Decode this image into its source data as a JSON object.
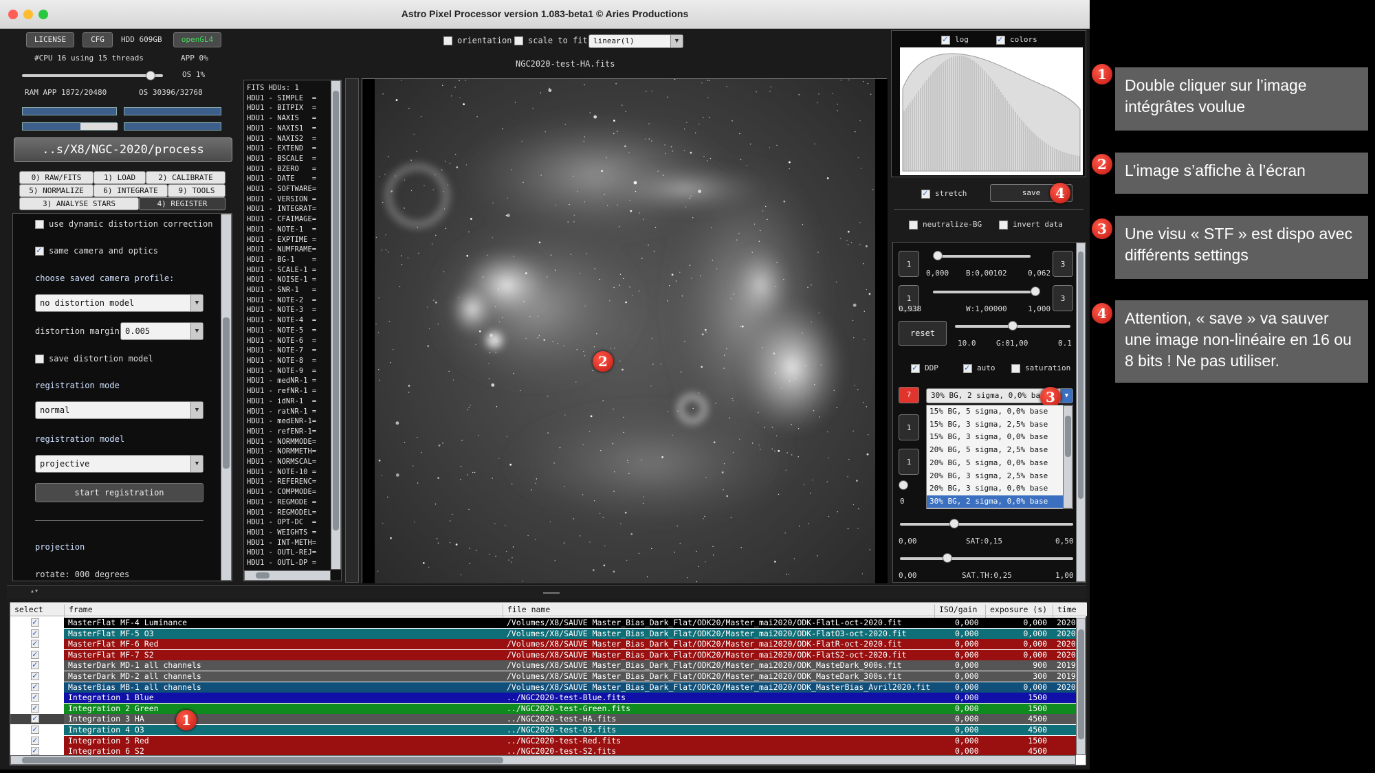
{
  "window": {
    "title": "Astro Pixel Processor version 1.083-beta1 © Aries Productions"
  },
  "status": {
    "license": "LICENSE",
    "cfg": "CFG",
    "hdd": "HDD 609GB",
    "opengl": "openGL4",
    "cpu": "#CPU 16  using 15 threads",
    "app": "APP 0%",
    "os": "OS 1%",
    "ram": "RAM  APP 1872/20480",
    "ram_os": "OS 30396/32768"
  },
  "path": "..s/X8/NGC-2020/process",
  "tabs": [
    {
      "label": "0) RAW/FITS"
    },
    {
      "label": "1) LOAD"
    },
    {
      "label": "2) CALIBRATE"
    },
    {
      "label": "5) NORMALIZE"
    },
    {
      "label": "6) INTEGRATE"
    },
    {
      "label": "9) TOOLS"
    },
    {
      "label": "3) ANALYSE STARS"
    },
    {
      "label": "4) REGISTER"
    }
  ],
  "register": {
    "dynamic_distortion": "use dynamic distortion correction",
    "same_camera": "same camera and optics",
    "choose_profile": "choose saved camera profile:",
    "profile_value": "no distortion model",
    "distortion_margin_label": "distortion margin",
    "distortion_margin_value": "0.005",
    "save_distortion": "save distortion model",
    "registration_mode_label": "registration mode",
    "registration_mode_value": "normal",
    "registration_model_label": "registration model",
    "registration_model_value": "projective",
    "start_button": "start registration",
    "projection": "projection",
    "rotate": "rotate:  000 degrees"
  },
  "fits_header": [
    "FITS HDUs: 1",
    "HDU1 - SIMPLE  =",
    "HDU1 - BITPIX  =",
    "HDU1 - NAXIS   =",
    "HDU1 - NAXIS1  =",
    "HDU1 - NAXIS2  =",
    "HDU1 - EXTEND  =",
    "HDU1 - BSCALE  =",
    "HDU1 - BZERO   =",
    "HDU1 - DATE    =",
    "HDU1 - SOFTWARE=",
    "HDU1 - VERSION =",
    "HDU1 - INTEGRAT=",
    "HDU1 - CFAIMAGE=",
    "HDU1 - NOTE-1  =",
    "HDU1 - EXPTIME =",
    "HDU1 - NUMFRAME=",
    "HDU1 - BG-1    =",
    "HDU1 - SCALE-1 =",
    "HDU1 - NOISE-1 =",
    "HDU1 - SNR-1   =",
    "HDU1 - NOTE-2  =",
    "HDU1 - NOTE-3  =",
    "HDU1 - NOTE-4  =",
    "HDU1 - NOTE-5  =",
    "HDU1 - NOTE-6  =",
    "HDU1 - NOTE-7  =",
    "HDU1 - NOTE-8  =",
    "HDU1 - NOTE-9  =",
    "HDU1 - medNR-1 =",
    "HDU1 - refNR-1 =",
    "HDU1 - idNR-1  =",
    "HDU1 - ratNR-1 =",
    "HDU1 - medENR-1=",
    "HDU1 - refENR-1=",
    "HDU1 - NORMMODE=",
    "HDU1 - NORMMETH=",
    "HDU1 - NORMSCAL=",
    "HDU1 - NOTE-10 =",
    "HDU1 - REFERENC=",
    "HDU1 - COMPMODE=",
    "HDU1 - REGMODE =",
    "HDU1 - REGMODEL=",
    "HDU1 - OPT-DC  =",
    "HDU1 - WEIGHTS =",
    "HDU1 - INT-METH=",
    "HDU1 - OUTL-REJ=",
    "HDU1 - OUTL-DP ="
  ],
  "viewer": {
    "orientation": "orientation",
    "scale_to_fit": "scale to fit",
    "stretch_mode": "linear(l)",
    "filename": "NGC2020-test-HA.fits"
  },
  "histogram": {
    "log": "log",
    "colors": "colors"
  },
  "stretch": {
    "stretch_label": "stretch",
    "save_label": "save",
    "neutralize": "neutralize-BG",
    "invert": "invert data",
    "b_min": "0,000",
    "b_val": "B:0,00102",
    "b_max": "0,062",
    "w_min": "0,938",
    "w_val": "W:1,00000",
    "w_max": "1,000",
    "reset": "reset",
    "g_min": "10.0",
    "g_val": "G:01,00",
    "g_max": "0.1",
    "ddp": "DDP",
    "auto": "auto",
    "saturation": "saturation",
    "question": "?",
    "preset_selected": "30% BG, 2 sigma, 0,0% ba",
    "presets": [
      "15% BG, 5 sigma, 0,0% base",
      "15% BG, 3 sigma, 2,5% base",
      "15% BG, 3 sigma, 0,0% base",
      "20% BG, 5 sigma, 2,5% base",
      "20% BG, 5 sigma, 0,0% base",
      "20% BG, 3 sigma, 2,5% base",
      "20% BG, 3 sigma, 0,0% base",
      "30% BG, 2 sigma, 0,0% base"
    ],
    "zero": "0",
    "sat_min": "0,00",
    "sat_val": "SAT:0,15",
    "sat_max": "0,50",
    "satth_min": "0,00",
    "satth_val": "SAT.TH:0,25",
    "satth_max": "1,00",
    "one": "1",
    "three": "3"
  },
  "filelist": {
    "headers": [
      "select",
      "frame",
      "file name",
      "ISO/gain",
      "exposure (s)",
      "time"
    ],
    "rows": [
      {
        "frame": "MasterFlat  MF-4 Luminance",
        "file": "/Volumes/X8/SAUVE Master_Bias_Dark_Flat/ODK20/Master_mai2020/ODK-FlatL-oct-2020.fit",
        "iso": "0,000",
        "exp": "0,000",
        "time": "2020",
        "bg": "#000000",
        "fg": "#ffffff"
      },
      {
        "frame": "MasterFlat  MF-5 O3",
        "file": "/Volumes/X8/SAUVE Master_Bias_Dark_Flat/ODK20/Master_mai2020/ODK-FlatO3-oct-2020.fit",
        "iso": "0,000",
        "exp": "0,000",
        "time": "2020",
        "bg": "#0f6f78",
        "fg": "#ffffff"
      },
      {
        "frame": "MasterFlat  MF-6 Red",
        "file": "/Volumes/X8/SAUVE Master_Bias_Dark_Flat/ODK20/Master_mai2020/ODK-FlatR-oct-2020.fit",
        "iso": "0,000",
        "exp": "0,000",
        "time": "2020",
        "bg": "#9a1010",
        "fg": "#ffffff"
      },
      {
        "frame": "MasterFlat  MF-7 S2",
        "file": "/Volumes/X8/SAUVE Master_Bias_Dark_Flat/ODK20/Master_mai2020/ODK-FlatS2-oct-2020.fit",
        "iso": "0,000",
        "exp": "0,000",
        "time": "2020",
        "bg": "#9a1010",
        "fg": "#ffffff"
      },
      {
        "frame": "MasterDark  MD-1 all channels",
        "file": "/Volumes/X8/SAUVE Master_Bias_Dark_Flat/ODK20/Master_mai2020/ODK_MasteDark_900s.fit",
        "iso": "0,000",
        "exp": "900",
        "time": "2019",
        "bg": "#555555",
        "fg": "#ffffff"
      },
      {
        "frame": "MasterDark  MD-2 all channels",
        "file": "/Volumes/X8/SAUVE Master_Bias_Dark_Flat/ODK20/Master_mai2020/ODK_MasteDark_300s.fit",
        "iso": "0,000",
        "exp": "300",
        "time": "2019",
        "bg": "#555555",
        "fg": "#ffffff"
      },
      {
        "frame": "MasterBias  MB-1 all channels",
        "file": "/Volumes/X8/SAUVE Master_Bias_Dark_Flat/ODK20/Master_mai2020/ODK_MasterBias_Avril2020.fit",
        "iso": "0,000",
        "exp": "0,000",
        "time": "2020",
        "bg": "#0f4f7a",
        "fg": "#ffffff"
      },
      {
        "frame": "Integration 1 Blue",
        "file": "../NGC2020-test-Blue.fits",
        "iso": "0,000",
        "exp": "1500",
        "time": "",
        "bg": "#1010a8",
        "fg": "#ffffff"
      },
      {
        "frame": "Integration 2 Green",
        "file": "../NGC2020-test-Green.fits",
        "iso": "0,000",
        "exp": "1500",
        "time": "",
        "bg": "#0f8a1e",
        "fg": "#ffffff"
      },
      {
        "frame": "Integration 3 HA",
        "file": "../NGC2020-test-HA.fits",
        "iso": "0,000",
        "exp": "4500",
        "time": "",
        "bg": "#555555",
        "fg": "#ffffff"
      },
      {
        "frame": "Integration 4 O3",
        "file": "../NGC2020-test-O3.fits",
        "iso": "0,000",
        "exp": "4500",
        "time": "",
        "bg": "#0f6f78",
        "fg": "#ffffff"
      },
      {
        "frame": "Integration 5 Red",
        "file": "../NGC2020-test-Red.fits",
        "iso": "0,000",
        "exp": "1500",
        "time": "",
        "bg": "#9a1010",
        "fg": "#ffffff"
      },
      {
        "frame": "Integration 6 S2",
        "file": "../NGC2020-test-S2.fits",
        "iso": "0,000",
        "exp": "4500",
        "time": "",
        "bg": "#9a1010",
        "fg": "#ffffff"
      }
    ]
  },
  "annotations": {
    "badges": [
      "1",
      "2",
      "3",
      "4"
    ],
    "notes": [
      "Double cliquer sur l’image intégrâtes voulue",
      "L’image s’affiche à l’écran",
      "Une visu « STF » est dispo avec différents settings",
      "Attention, « save » va sauver une image non-linéaire en 16 ou 8 bits ! Ne pas utiliser."
    ]
  },
  "colors": {
    "accent": "#1a5bd8",
    "badge": "#d81e14",
    "note_bg": "#5f5f5f"
  }
}
